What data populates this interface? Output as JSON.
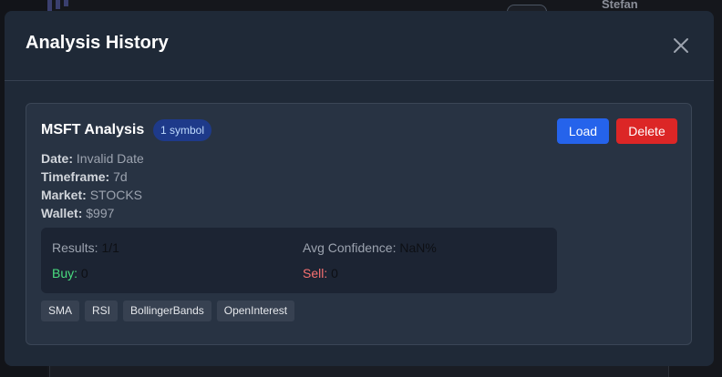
{
  "background": {
    "user_name": "Stefan"
  },
  "modal": {
    "title": "Analysis History",
    "close_icon": "close-icon"
  },
  "analysis": {
    "name": "MSFT Analysis",
    "badge": "1 symbol",
    "load_label": "Load",
    "delete_label": "Delete",
    "date_label": "Date:",
    "date_value": "Invalid Date",
    "timeframe_label": "Timeframe:",
    "timeframe_value": "7d",
    "market_label": "Market:",
    "market_value": "STOCKS",
    "wallet_label": "Wallet:",
    "wallet_value": "$997",
    "stats": {
      "results_label": "Results:",
      "results_value": "1/1",
      "confidence_label": "Avg Confidence:",
      "confidence_value": "NaN%",
      "buy_label": "Buy:",
      "buy_value": "0",
      "sell_label": "Sell:",
      "sell_value": "0"
    },
    "indicators": [
      "SMA",
      "RSI",
      "BollingerBands",
      "OpenInterest"
    ]
  },
  "colors": {
    "modal_bg": "#1f2937",
    "card_bg": "#283343",
    "load": "#2563eb",
    "delete": "#dc2626",
    "buy": "#4ade80",
    "sell": "#f87171",
    "badge_bg": "#1e3a8a"
  }
}
